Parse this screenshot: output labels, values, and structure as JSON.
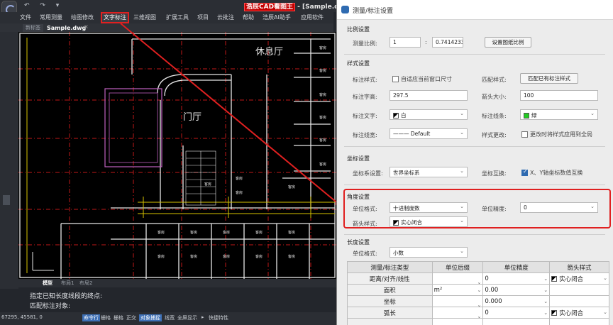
{
  "window": {
    "title_highlight": "浩辰CAD看图王",
    "title_rest": " - [Sample.dwg]",
    "quick_access": "↶ ↷ ▾"
  },
  "menubar": [
    "文件",
    "常用测量",
    "绘图修改",
    "文字标注",
    "三维视图",
    "扩展工具",
    "项目",
    "云批注",
    "帮助",
    "浩辰AI助手",
    "应用软件"
  ],
  "tabs": {
    "start": "新标签",
    "file": "Sample.dwg"
  },
  "canvas": {
    "room_labels": [
      "休息厅",
      "门厅"
    ],
    "small_labels": [
      "客房",
      "客房",
      "客房",
      "客房",
      "客房",
      "客房",
      "客房",
      "客房",
      "客房",
      "客房",
      "客房",
      "客房",
      "客房",
      "客房",
      "客房",
      "客房",
      "客房",
      "客房",
      "客房",
      "客房"
    ]
  },
  "layout_tabs": [
    "模型",
    "布局1",
    "布局2"
  ],
  "command": {
    "line1": "指定已知长度线段的终点:",
    "line2": "匹配标注对象:"
  },
  "status": {
    "coords": "67295, 45581, 0",
    "items": [
      "命令行",
      "栅格",
      "栅格",
      "正交",
      "对象捕捉",
      "线宽",
      "全屏显示",
      "▸",
      "快捷特性"
    ]
  },
  "dialog": {
    "title": "测量/标注设置",
    "scale": {
      "section": "比例设置",
      "label": "测量比例:",
      "left": "1",
      "colon": ":",
      "right": "0.7414233",
      "button": "设置图纸比例"
    },
    "style": {
      "section": "样式设置",
      "dim_style_label": "标注样式:",
      "dim_style_check": "自适应当前窗口尺寸",
      "match_label": "匹配样式:",
      "match_button": "匹配已有标注样式",
      "text_height_label": "标注字高:",
      "text_height": "297.5",
      "arrow_size_label": "箭头大小:",
      "arrow_size": "100",
      "text_label": "标注文字:",
      "text_value": "白",
      "line_label": "标注线条:",
      "line_value": "绿",
      "linetype_label": "标注线宽:",
      "linetype_value": "——— Default",
      "style_change_label": "样式更改:",
      "style_change_check": "更改时将样式应用到全局"
    },
    "coord": {
      "section": "坐标设置",
      "system_label": "坐标系设置:",
      "system_value": "世界坐标系",
      "swap_label": "坐标互换:",
      "swap_check": "X、Y轴坐标数值互换"
    },
    "angle": {
      "section": "角度设置",
      "unit_label": "单位格式:",
      "unit_value": "十进制度数",
      "precision_label": "单位精度:",
      "precision_value": "0",
      "arrow_label": "箭头样式:",
      "arrow_value": "实心闭合"
    },
    "length": {
      "section": "长度设置",
      "unit_label": "单位格式:",
      "unit_value": "小数",
      "headers": [
        "测量/标注类型",
        "单位后缀",
        "单位精度",
        "箭头样式"
      ],
      "rows": [
        {
          "type": "距离/对齐/线性",
          "suffix": "",
          "precision": "0",
          "arrow": "实心闭合"
        },
        {
          "type": "面积",
          "suffix": "m²",
          "precision": "0.00",
          "arrow": ""
        },
        {
          "type": "坐标",
          "suffix": "",
          "precision": "0.000",
          "arrow": ""
        },
        {
          "type": "弧长",
          "suffix": "",
          "precision": "0",
          "arrow": "实心闭合"
        },
        {
          "type": "",
          "suffix": "",
          "precision": "",
          "arrow": ""
        }
      ]
    }
  },
  "colors": {
    "highlight_red": "#e02020",
    "accent_blue": "#2f6bb1",
    "cad_bg": "#000000"
  }
}
